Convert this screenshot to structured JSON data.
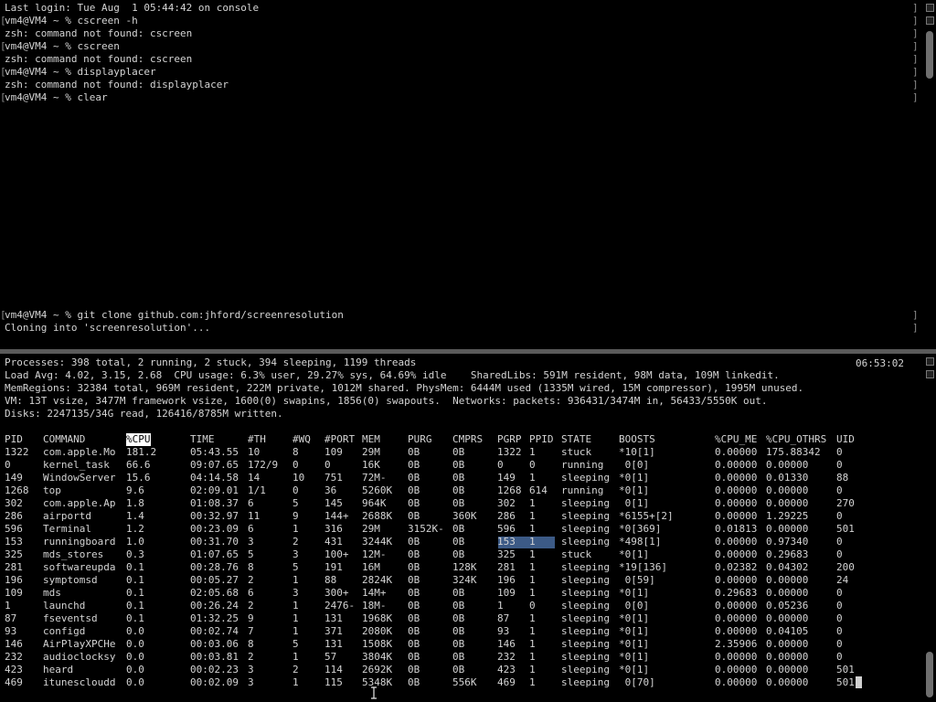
{
  "top_terminal": {
    "lines": [
      "Last login: Tue Aug  1 05:44:42 on console",
      "vm4@VM4 ~ % cscreen -h",
      "zsh: command not found: cscreen",
      "vm4@VM4 ~ % cscreen",
      "zsh: command not found: cscreen",
      "vm4@VM4 ~ % displayplacer",
      "zsh: command not found: displayplacer",
      "vm4@VM4 ~ % clear"
    ],
    "bottom_lines": [
      "vm4@VM4 ~ % git clone github.com:jhford/screenresolution",
      "Cloning into 'screenresolution'..."
    ]
  },
  "top_display": {
    "clock": "06:53:02",
    "summary": [
      "Processes: 398 total, 2 running, 2 stuck, 394 sleeping, 1199 threads",
      "Load Avg: 4.02, 3.15, 2.68  CPU usage: 6.3% user, 29.27% sys, 64.69% idle    SharedLibs: 591M resident, 98M data, 109M linkedit.",
      "MemRegions: 32384 total, 969M resident, 222M private, 1012M shared. PhysMem: 6444M used (1335M wired, 15M compressor), 1995M unused.",
      "VM: 13T vsize, 3477M framework vsize, 1600(0) swapins, 1856(0) swapouts.  Networks: packets: 936431/3474M in, 56433/5550K out.",
      "Disks: 2247135/34G read, 126416/8785M written."
    ],
    "columns": [
      "PID",
      "COMMAND",
      "%CPU",
      "TIME",
      "#TH",
      "#WQ",
      "#PORT",
      "MEM",
      "PURG",
      "CMPRS",
      "PGRP",
      "PPID",
      "STATE",
      "BOOSTS",
      "%CPU_ME",
      "%CPU_OTHRS",
      "UID"
    ],
    "sorted_column": "%CPU",
    "rows": [
      [
        "1322",
        "com.apple.Mo",
        "181.2",
        "05:43.55",
        "10",
        "8",
        "109",
        "29M",
        "0B",
        "0B",
        "1322",
        "1",
        "stuck",
        "*10[1]",
        "0.00000",
        "175.88342",
        "0"
      ],
      [
        "0",
        "kernel_task",
        "66.6",
        "09:07.65",
        "172/9",
        "0",
        "0",
        "16K",
        "0B",
        "0B",
        "0",
        "0",
        "running",
        " 0[0]",
        "0.00000",
        "0.00000",
        "0"
      ],
      [
        "149",
        "WindowServer",
        "15.6",
        "04:14.58",
        "14",
        "10",
        "751",
        "72M-",
        "0B",
        "0B",
        "149",
        "1",
        "sleeping",
        "*0[1]",
        "0.00000",
        "0.01330",
        "88"
      ],
      [
        "1268",
        "top",
        "9.6",
        "02:09.01",
        "1/1",
        "0",
        "36",
        "5260K",
        "0B",
        "0B",
        "1268",
        "614",
        "running",
        "*0[1]",
        "0.00000",
        "0.00000",
        "0"
      ],
      [
        "302",
        "com.apple.Ap",
        "1.8",
        "01:08.37",
        "6",
        "5",
        "145",
        "964K",
        "0B",
        "0B",
        "302",
        "1",
        "sleeping",
        " 0[1]",
        "0.00000",
        "0.00000",
        "270"
      ],
      [
        "286",
        "airportd",
        "1.4",
        "00:32.97",
        "11",
        "9",
        "144+",
        "2688K",
        "0B",
        "360K",
        "286",
        "1",
        "sleeping",
        "*6155+[2]",
        "0.00000",
        "1.29225",
        "0"
      ],
      [
        "596",
        "Terminal",
        "1.2",
        "00:23.09",
        "6",
        "1",
        "316",
        "29M",
        "3152K-",
        "0B",
        "596",
        "1",
        "sleeping",
        "*0[369]",
        "0.01813",
        "0.00000",
        "501"
      ],
      [
        "153",
        "runningboard",
        "1.0",
        "00:31.70",
        "3",
        "2",
        "431",
        "3244K",
        "0B",
        "0B",
        "153",
        "1",
        "sleeping",
        "*498[1]",
        "0.00000",
        "0.97340",
        "0"
      ],
      [
        "325",
        "mds_stores",
        "0.3",
        "01:07.65",
        "5",
        "3",
        "100+",
        "12M-",
        "0B",
        "0B",
        "325",
        "1",
        "stuck",
        "*0[1]",
        "0.00000",
        "0.29683",
        "0"
      ],
      [
        "281",
        "softwareupda",
        "0.1",
        "00:28.76",
        "8",
        "5",
        "191",
        "16M",
        "0B",
        "128K",
        "281",
        "1",
        "sleeping",
        "*19[136]",
        "0.02382",
        "0.04302",
        "200"
      ],
      [
        "196",
        "symptomsd",
        "0.1",
        "00:05.27",
        "2",
        "1",
        "88",
        "2824K",
        "0B",
        "324K",
        "196",
        "1",
        "sleeping",
        " 0[59]",
        "0.00000",
        "0.00000",
        "24"
      ],
      [
        "109",
        "mds",
        "0.1",
        "02:05.68",
        "6",
        "3",
        "300+",
        "14M+",
        "0B",
        "0B",
        "109",
        "1",
        "sleeping",
        "*0[1]",
        "0.29683",
        "0.00000",
        "0"
      ],
      [
        "1",
        "launchd",
        "0.1",
        "00:26.24",
        "2",
        "1",
        "2476-",
        "18M-",
        "0B",
        "0B",
        "1",
        "0",
        "sleeping",
        " 0[0]",
        "0.00000",
        "0.05236",
        "0"
      ],
      [
        "87",
        "fseventsd",
        "0.1",
        "01:32.25",
        "9",
        "1",
        "131",
        "1968K",
        "0B",
        "0B",
        "87",
        "1",
        "sleeping",
        "*0[1]",
        "0.00000",
        "0.00000",
        "0"
      ],
      [
        "93",
        "configd",
        "0.0",
        "00:02.74",
        "7",
        "1",
        "371",
        "2080K",
        "0B",
        "0B",
        "93",
        "1",
        "sleeping",
        "*0[1]",
        "0.00000",
        "0.04105",
        "0"
      ],
      [
        "146",
        "AirPlayXPCHe",
        "0.0",
        "00:03.06",
        "8",
        "5",
        "131",
        "1508K",
        "0B",
        "0B",
        "146",
        "1",
        "sleeping",
        "*0[1]",
        "2.35906",
        "0.00000",
        "0"
      ],
      [
        "232",
        "audioclocksy",
        "0.0",
        "00:03.81",
        "2",
        "1",
        "57",
        "3804K",
        "0B",
        "0B",
        "232",
        "1",
        "sleeping",
        "*0[1]",
        "0.00000",
        "0.00000",
        "0"
      ],
      [
        "423",
        "heard",
        "0.0",
        "00:02.23",
        "3",
        "2",
        "114",
        "2692K",
        "0B",
        "0B",
        "423",
        "1",
        "sleeping",
        "*0[1]",
        "0.00000",
        "0.00000",
        "501"
      ],
      [
        "469",
        "itunescloudd",
        "0.0",
        "00:02.09",
        "3",
        "1",
        "115",
        "5348K",
        "0B",
        "556K",
        "469",
        "1",
        "sleeping",
        " 0[70]",
        "0.00000",
        "0.00000",
        "501"
      ]
    ],
    "selected_row": 7
  },
  "scroll_position": {
    "top_pane": 0.0,
    "bottom_pane": 1.0
  }
}
